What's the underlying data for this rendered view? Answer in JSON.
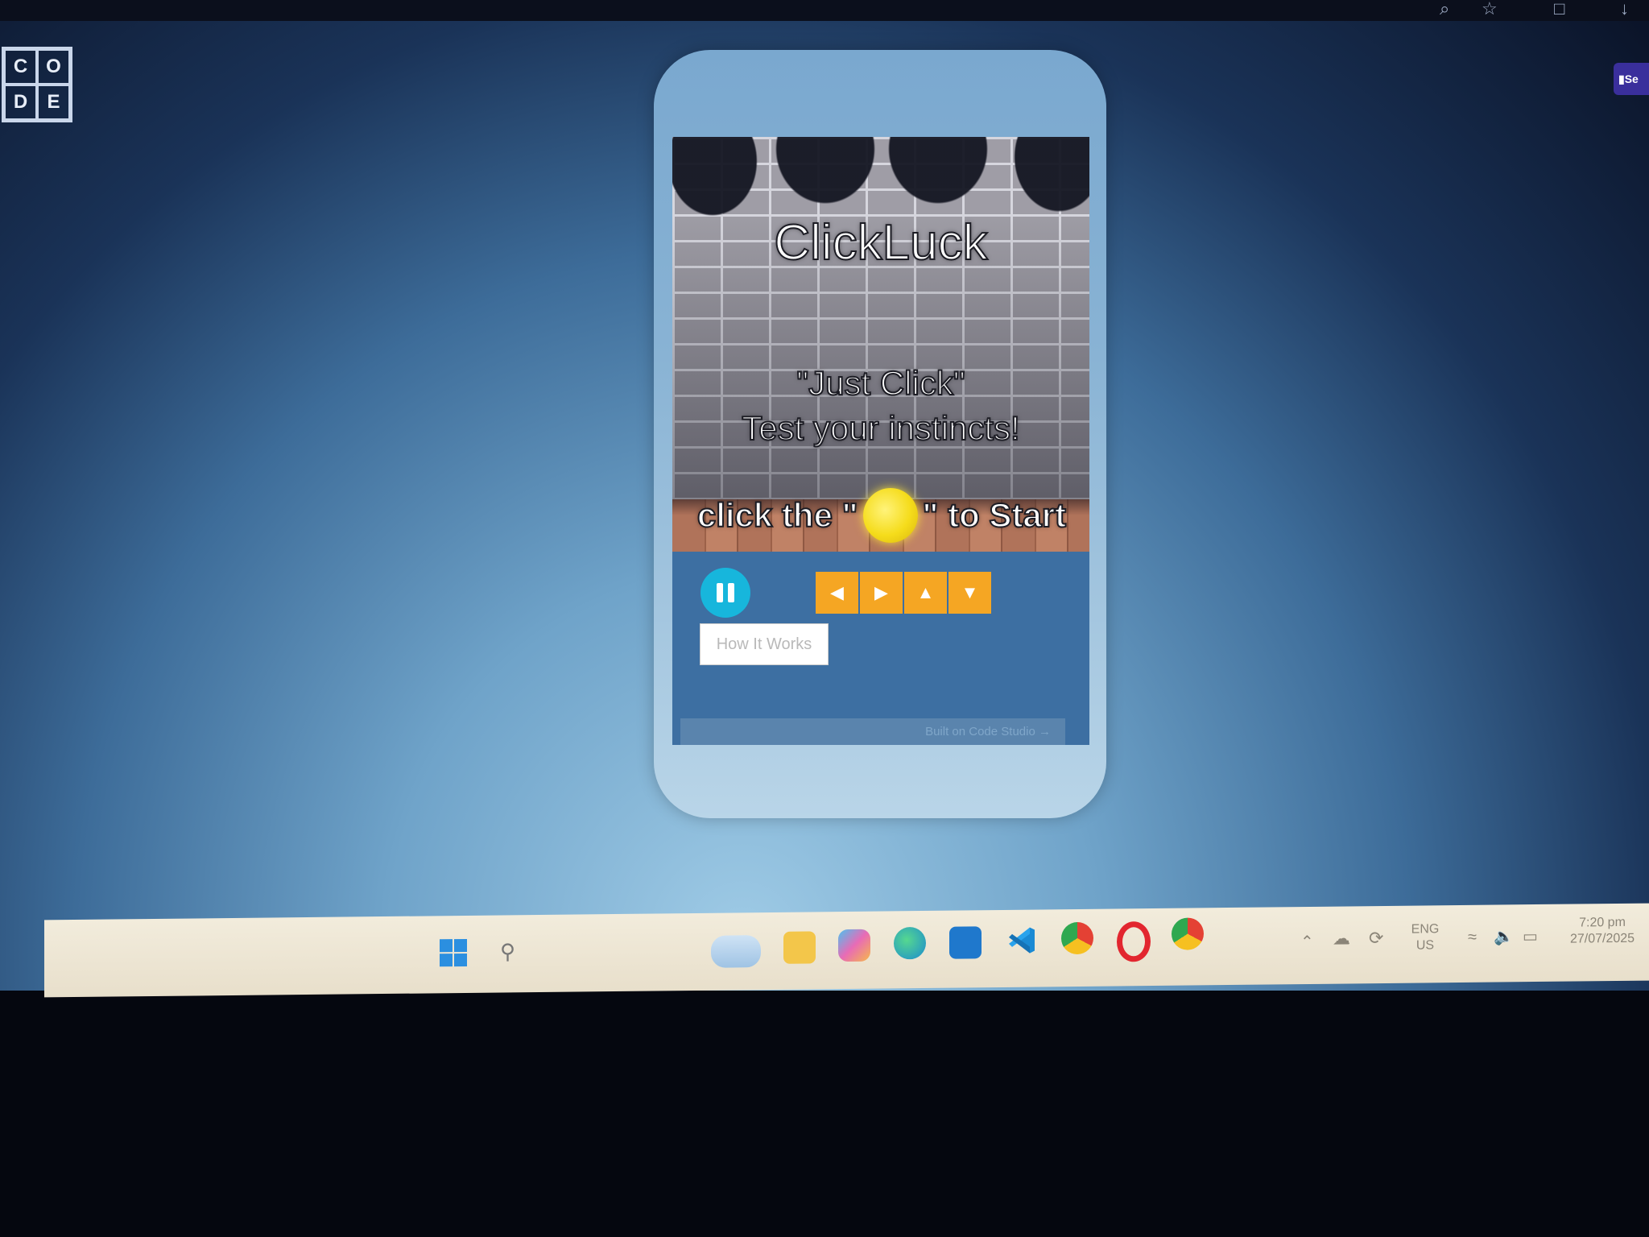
{
  "logo": {
    "letters": [
      "C",
      "O",
      "D",
      "E"
    ]
  },
  "share_button": {
    "label": "Se"
  },
  "game": {
    "title": "ClickLuck",
    "tagline_1": "\"Just Click\"",
    "tagline_2": "Test your instincts!",
    "start_prefix": "click  the \"",
    "start_suffix": "\" to Start",
    "how_it_works": "How It Works",
    "footer": "Built on Code Studio →"
  },
  "controls": {
    "pause": "pause-icon",
    "dpad": [
      "◀",
      "▶",
      "▲",
      "▼"
    ]
  },
  "taskbar": {
    "language": "ENG",
    "region": "US",
    "time": "7:20 pm",
    "date": "27/07/2025",
    "apps": [
      "start-icon",
      "search-icon",
      "weather-icon",
      "file-explorer-icon",
      "copilot-icon",
      "edge-icon",
      "outlook-icon",
      "vscode-icon",
      "chrome-icon",
      "opera-icon",
      "chrome-profile-icon"
    ]
  },
  "colors": {
    "accent_orange": "#f5a623",
    "pause_blue": "#17b6dc",
    "coin_yellow": "#f5dc1b",
    "app_blue": "#3d6fa2"
  }
}
